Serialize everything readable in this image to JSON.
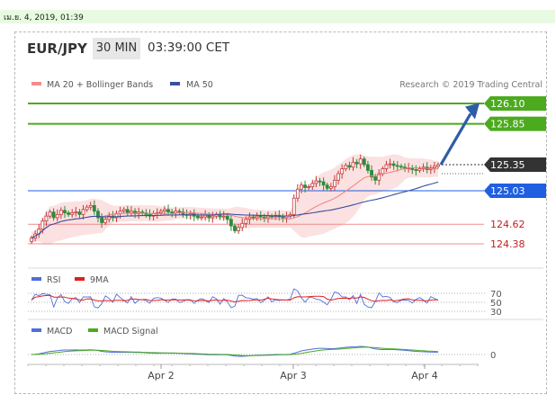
{
  "date_stamp": "เม.ย. 4, 2019, 01:39",
  "header": {
    "pair": "EUR/JPY",
    "timeframe": "30 MIN",
    "time": "03:39:00 CET"
  },
  "legend": {
    "ma20": "MA 20 + Bollinger Bands",
    "ma50": "MA 50",
    "credit": "Research © 2019 Trading Central"
  },
  "colors": {
    "up": "#c23b3b",
    "down": "#2e8b3b",
    "green_level": "#4caa1e",
    "blue_level": "#1f5fe0",
    "red_level": "#f28c8c",
    "ma20": "#f08080",
    "ma50": "#3a4fa0",
    "arrow": "#2e5da8",
    "rsi": "#4e6fd8",
    "ma9": "#e02020",
    "macd": "#4e6fd8",
    "signal": "#4caa1e"
  },
  "chart_data": [
    {
      "type": "candlestick",
      "pair": "EUR/JPY",
      "timeframe": "30 MIN",
      "x_ticks": [
        "Apr 2",
        "Apr 3",
        "Apr 4"
      ],
      "levels": [
        {
          "value": 126.1,
          "label": "126.10",
          "kind": "resistance"
        },
        {
          "value": 125.85,
          "label": "125.85",
          "kind": "resistance"
        },
        {
          "value": 125.35,
          "label": "125.35",
          "kind": "current"
        },
        {
          "value": 125.03,
          "label": "125.03",
          "kind": "pivot"
        },
        {
          "value": 124.62,
          "label": "124.62",
          "kind": "support"
        },
        {
          "value": 124.38,
          "label": "124.38",
          "kind": "support"
        }
      ],
      "close": [
        124.45,
        124.5,
        124.56,
        124.66,
        124.72,
        124.77,
        124.7,
        124.74,
        124.79,
        124.76,
        124.74,
        124.76,
        124.77,
        124.74,
        124.8,
        124.83,
        124.85,
        124.78,
        124.7,
        124.64,
        124.68,
        124.72,
        124.7,
        124.75,
        124.78,
        124.8,
        124.76,
        124.78,
        124.75,
        124.77,
        124.76,
        124.74,
        124.72,
        124.75,
        124.76,
        124.78,
        124.8,
        124.77,
        124.76,
        124.78,
        124.77,
        124.74,
        124.73,
        124.75,
        124.72,
        124.7,
        124.71,
        124.73,
        124.7,
        124.72,
        124.74,
        124.71,
        124.72,
        124.68,
        124.6,
        124.54,
        124.58,
        124.63,
        124.68,
        124.71,
        124.7,
        124.72,
        124.71,
        124.7,
        124.72,
        124.71,
        124.73,
        124.71,
        124.7,
        124.72,
        124.74,
        124.94,
        125.05,
        125.1,
        125.07,
        125.08,
        125.12,
        125.15,
        125.14,
        125.1,
        125.06,
        125.08,
        125.16,
        125.24,
        125.3,
        125.34,
        125.32,
        125.38,
        125.36,
        125.42,
        125.35,
        125.28,
        125.2,
        125.16,
        125.24,
        125.3,
        125.35,
        125.36,
        125.34,
        125.33,
        125.32,
        125.3,
        125.31,
        125.29,
        125.28,
        125.3,
        125.32,
        125.29,
        125.31,
        125.33,
        125.35
      ],
      "rsi": {
        "levels": [
          70,
          50,
          30
        ]
      },
      "macd": {
        "levels": [
          0
        ]
      }
    }
  ]
}
